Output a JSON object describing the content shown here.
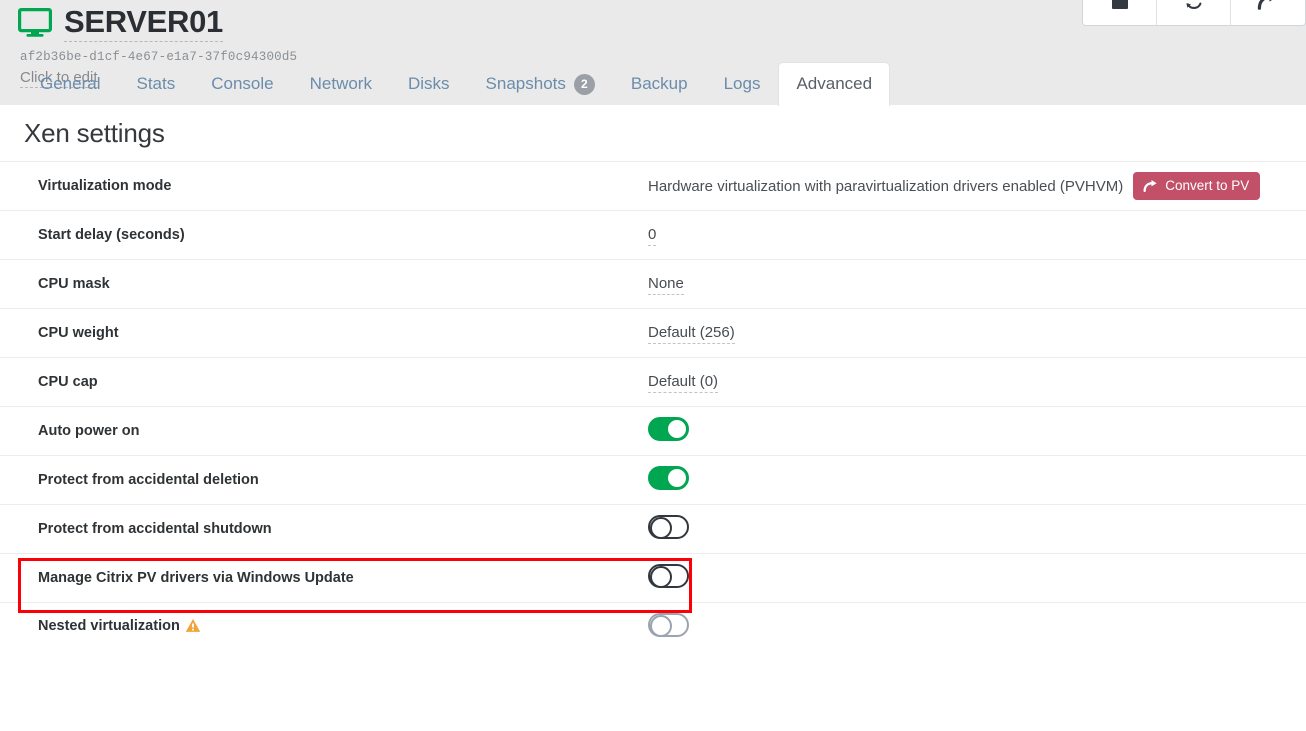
{
  "header": {
    "vm_name": "SERVER01",
    "uuid": "af2b36be-d1cf-4e67-e1a7-37f0c94300d5",
    "edit_hint": "Click to edit",
    "monitor_icon": "monitor-icon",
    "monitor_color": "#00a650"
  },
  "toolbar": {
    "buttons": [
      {
        "name": "stop-button",
        "icon": "stop-square-icon"
      },
      {
        "name": "reboot-button",
        "icon": "refresh-cycle-icon"
      },
      {
        "name": "migrate-button",
        "icon": "forward-arrow-icon"
      }
    ]
  },
  "tabs": [
    {
      "label": "General",
      "badge": null,
      "active": false
    },
    {
      "label": "Stats",
      "badge": null,
      "active": false
    },
    {
      "label": "Console",
      "badge": null,
      "active": false
    },
    {
      "label": "Network",
      "badge": null,
      "active": false
    },
    {
      "label": "Disks",
      "badge": null,
      "active": false
    },
    {
      "label": "Snapshots",
      "badge": "2",
      "active": false
    },
    {
      "label": "Backup",
      "badge": null,
      "active": false
    },
    {
      "label": "Logs",
      "badge": null,
      "active": false
    },
    {
      "label": "Advanced",
      "badge": null,
      "active": true
    }
  ],
  "section": {
    "title": "Xen settings"
  },
  "rows": [
    {
      "label": "Virtualization mode",
      "type": "text-with-button",
      "value": "Hardware virtualization with paravirtualization drivers enabled (PVHVM)",
      "button_label": "Convert to PV",
      "button_color": "#c25069",
      "button_icon": "forward-arrow-icon"
    },
    {
      "label": "Start delay (seconds)",
      "type": "editable",
      "value": "0"
    },
    {
      "label": "CPU mask",
      "type": "editable",
      "value": "None"
    },
    {
      "label": "CPU weight",
      "type": "editable",
      "value": "Default (256)"
    },
    {
      "label": "CPU cap",
      "type": "editable",
      "value": "Default (0)"
    },
    {
      "label": "Auto power on",
      "type": "toggle",
      "state": "on"
    },
    {
      "label": "Protect from accidental deletion",
      "type": "toggle",
      "state": "on"
    },
    {
      "label": "Protect from accidental shutdown",
      "type": "toggle",
      "state": "off",
      "highlighted": true
    },
    {
      "label": "Manage Citrix PV drivers via Windows Update",
      "type": "toggle",
      "state": "off"
    },
    {
      "label": "Nested virtualization",
      "type": "toggle",
      "state": "off",
      "muted": true,
      "warning_icon": "warning-triangle-icon"
    }
  ],
  "colors": {
    "toggle_on": "#00a650",
    "toggle_off_border": "#32373d",
    "highlight": "#fb0007",
    "warning": "#f0a43a",
    "header_bg": "#eaeaea",
    "tab_link": "#6b8cab"
  }
}
